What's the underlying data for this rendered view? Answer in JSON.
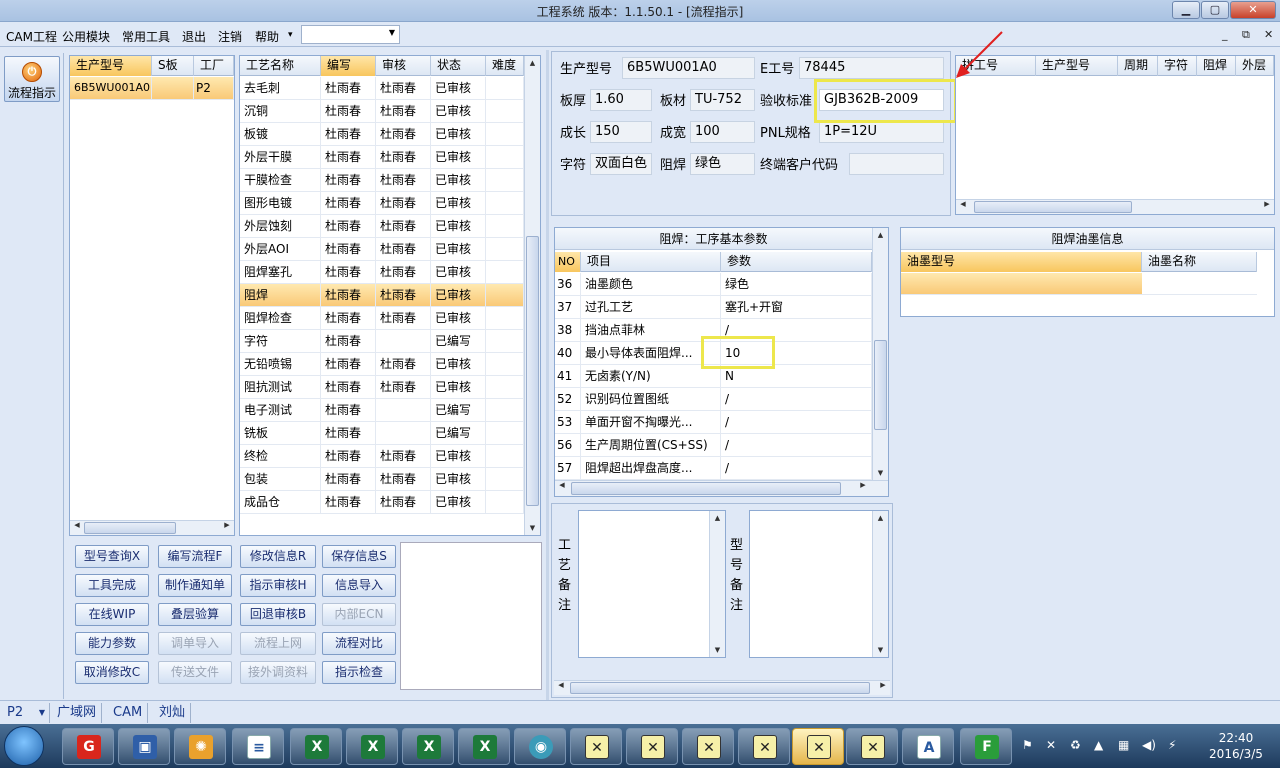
{
  "window": {
    "title": "工程系统   版本：1.1.50.1 - [流程指示]"
  },
  "menu": {
    "items": [
      "CAM工程",
      "公用模块",
      "常用工具",
      "退出",
      "注销",
      "帮助"
    ],
    "help_arrow": "▾",
    "select_value": ""
  },
  "nav": {
    "button_label": "流程指示"
  },
  "product_list": {
    "headers": [
      "生产型号",
      "S板",
      "工厂"
    ],
    "rows": [
      {
        "model": "6B5WU001A0",
        "s": "",
        "factory": "P2"
      }
    ]
  },
  "process": {
    "headers": [
      "工艺名称",
      "编写",
      "审核",
      "状态",
      "难度"
    ],
    "rows": [
      [
        "去毛刺",
        "杜雨春",
        "杜雨春",
        "已审核"
      ],
      [
        "沉铜",
        "杜雨春",
        "杜雨春",
        "已审核"
      ],
      [
        "板镀",
        "杜雨春",
        "杜雨春",
        "已审核"
      ],
      [
        "外层干膜",
        "杜雨春",
        "杜雨春",
        "已审核"
      ],
      [
        "干膜检查",
        "杜雨春",
        "杜雨春",
        "已审核"
      ],
      [
        "图形电镀",
        "杜雨春",
        "杜雨春",
        "已审核"
      ],
      [
        "外层蚀刻",
        "杜雨春",
        "杜雨春",
        "已审核"
      ],
      [
        "外层AOI",
        "杜雨春",
        "杜雨春",
        "已审核"
      ],
      [
        "阻焊塞孔",
        "杜雨春",
        "杜雨春",
        "已审核"
      ],
      [
        "阻焊",
        "杜雨春",
        "杜雨春",
        "已审核"
      ],
      [
        "阻焊检查",
        "杜雨春",
        "杜雨春",
        "已审核"
      ],
      [
        "字符",
        "杜雨春",
        "",
        "已编写"
      ],
      [
        "无铅喷锡",
        "杜雨春",
        "杜雨春",
        "已审核"
      ],
      [
        "阻抗测试",
        "杜雨春",
        "杜雨春",
        "已审核"
      ],
      [
        "电子测试",
        "杜雨春",
        "",
        "已编写"
      ],
      [
        "铣板",
        "杜雨春",
        "",
        "已编写"
      ],
      [
        "终检",
        "杜雨春",
        "杜雨春",
        "已审核"
      ],
      [
        "包装",
        "杜雨春",
        "杜雨春",
        "已审核"
      ],
      [
        "成品仓",
        "杜雨春",
        "杜雨春",
        "已审核"
      ]
    ]
  },
  "buttons": [
    [
      "型号查询X",
      "编写流程F",
      "修改信息R",
      "保存信息S"
    ],
    [
      "工具完成",
      "制作通知单",
      "指示审核H",
      "信息导入"
    ],
    [
      "在线WIP",
      "叠层验算",
      "回退审核B",
      "内部ECN"
    ],
    [
      "能力参数",
      "调单导入",
      "流程上网",
      "流程对比"
    ],
    [
      "取消修改C",
      "传送文件",
      "接外调资料",
      "指示检查"
    ]
  ],
  "info": {
    "labels": {
      "model": "生产型号",
      "e_no": "E工号",
      "thickness": "板厚",
      "material": "板材",
      "standard": "验收标准",
      "length": "成长",
      "width": "成宽",
      "pnl": "PNL规格",
      "char": "字符",
      "mask": "阻焊",
      "customer": "终端客户代码"
    },
    "values": {
      "model": "6B5WU001A0",
      "e_no": "78445",
      "thickness": "1.60",
      "material": "TU-752",
      "standard": "GJB362B-2009",
      "length": "150",
      "width": "100",
      "pnl": "1P=12U",
      "char": "双面白色",
      "mask": "绿色",
      "customer": ""
    }
  },
  "panel_grid": {
    "headers": [
      "拼工号",
      "生产型号",
      "周期",
      "字符",
      "阻焊",
      "外层"
    ]
  },
  "params": {
    "title": "阻焊：工序基本参数",
    "headers": [
      "NO",
      "项目",
      "参数"
    ],
    "rows": [
      [
        "36",
        "油墨颜色",
        "绿色"
      ],
      [
        "37",
        "过孔工艺",
        "塞孔+开窗"
      ],
      [
        "38",
        "挡油点菲林",
        "/"
      ],
      [
        "40",
        "最小导体表面阻焊...",
        "10"
      ],
      [
        "41",
        "无卤素(Y/N)",
        "N"
      ],
      [
        "52",
        "识别码位置图纸",
        "/"
      ],
      [
        "53",
        "单面开窗不掏曝光...",
        "/"
      ],
      [
        "56",
        "生产周期位置(CS+SS)",
        "/"
      ],
      [
        "57",
        "阻焊超出焊盘高度...",
        "/"
      ]
    ]
  },
  "ink": {
    "title": "阻焊油墨信息",
    "headers": [
      "油墨型号",
      "油墨名称"
    ]
  },
  "notes": {
    "process_label": "工艺备注",
    "model_label": "型号备注"
  },
  "status": {
    "items": [
      "P2",
      "广域网",
      "CAM",
      "刘灿"
    ]
  },
  "clock": {
    "time": "22:40",
    "date": "2016/3/5"
  },
  "colors": {
    "selected_row": "#f9c977",
    "highlight_box": "#ede74c",
    "arrow": "#e02020"
  }
}
